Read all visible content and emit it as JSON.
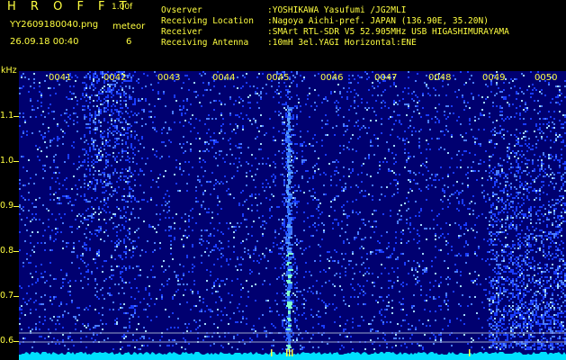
{
  "header": {
    "brand": "H R O F F T",
    "version": "1.00f",
    "filename": "YY2609180040.png",
    "meteor_label": "meteor",
    "datetime": "26.09.18 00:40",
    "meteor_count": "6",
    "observer_label": "Ovserver",
    "observer_value": ":YOSHIKAWA Yasufumi /JG2MLI",
    "location_label": "Receiving Location",
    "location_value": ":Nagoya Aichi-pref. JAPAN (136.90E, 35.20N)",
    "receiver_label": "Receiver",
    "receiver_value": ":SMArt RTL-SDR V5 52.905MHz USB HIGASHIMURAYAMA",
    "antenna_label": "Receiving Antenna",
    "antenna_value": ":10mH 3el.YAGI Horizontal:ENE"
  },
  "axis": {
    "unit": "kHz",
    "freq_labels": [
      "1.1",
      "1.0",
      "0.9",
      "0.8",
      "0.7",
      "0.6"
    ],
    "time_labels": [
      "0041",
      "0042",
      "0043",
      "0044",
      "0045",
      "0046",
      "0047",
      "0048",
      "0049",
      "0050"
    ]
  },
  "colors": {
    "text": "#ffff40",
    "background": "#000000",
    "spectrum_base": "#000070",
    "noise_floor": "#00e0ff"
  }
}
